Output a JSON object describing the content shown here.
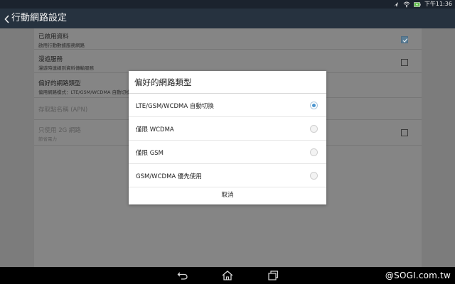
{
  "status_bar": {
    "time": "下午11:36"
  },
  "action_bar": {
    "title": "行動網路設定"
  },
  "settings": [
    {
      "title": "已啟用資料",
      "subtitle": "啟用行動數據服務網路",
      "checked": true,
      "disabled": false
    },
    {
      "title": "漫遊服務",
      "subtitle": "漫遊時連線到資料傳輸服務",
      "checked": false,
      "disabled": false
    },
    {
      "title": "偏好的網路類型",
      "subtitle": "偏用網路模式：LTE/GSM/WCDMA 自動切換",
      "disabled": false
    },
    {
      "title": "存取點名稱 (APN)",
      "disabled": true
    },
    {
      "title": "只使用 2G 網路",
      "subtitle": "節省電力",
      "checked": false,
      "disabled": true
    }
  ],
  "dialog": {
    "title": "偏好的網路類型",
    "options": [
      {
        "label": "LTE/GSM/WCDMA 自動切換",
        "selected": true
      },
      {
        "label": "僅限 WCDMA",
        "selected": false
      },
      {
        "label": "僅限 GSM",
        "selected": false
      },
      {
        "label": "GSM/WCDMA 優先使用",
        "selected": false
      }
    ],
    "cancel_label": "取消"
  },
  "watermark": "@SOGI.com.tw",
  "colors": {
    "accent_blue": "#4a95cf",
    "actionbar": "#26323f",
    "statusbar": "#1b232e"
  }
}
